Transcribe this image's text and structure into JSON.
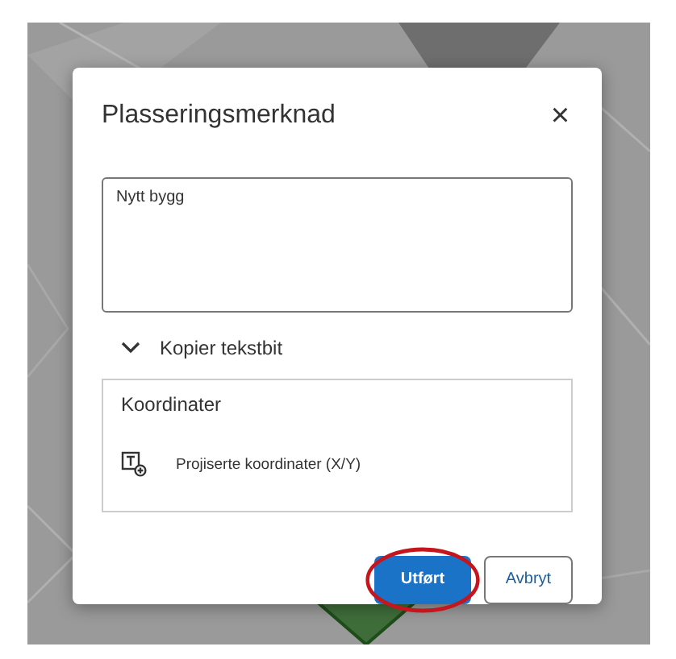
{
  "dialog": {
    "title": "Plasseringsmerknad",
    "close_icon": "×",
    "note": {
      "value": "Nytt bygg"
    },
    "snippet": {
      "label": "Kopier tekstbit",
      "expanded": true,
      "group_title": "Koordinater",
      "items": [
        {
          "label": "Projiserte koordinater (X/Y)"
        }
      ]
    },
    "buttons": [
      {
        "label": "Utført",
        "kind": "primary",
        "circled": true
      },
      {
        "label": "Avbryt",
        "kind": "secondary",
        "circled": false
      }
    ]
  }
}
